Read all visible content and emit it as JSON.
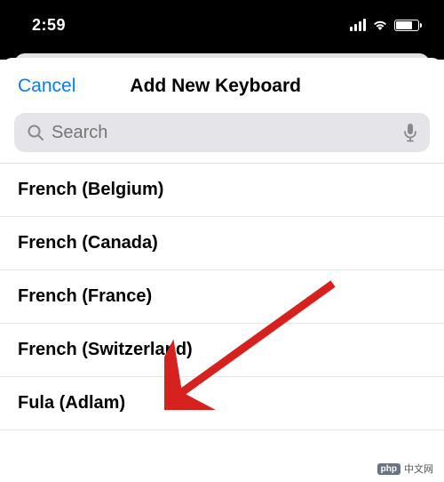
{
  "status": {
    "time": "2:59"
  },
  "nav": {
    "cancel": "Cancel",
    "title": "Add New Keyboard"
  },
  "search": {
    "placeholder": "Search"
  },
  "list": {
    "items": [
      {
        "label": "French (Belgium)"
      },
      {
        "label": "French (Canada)"
      },
      {
        "label": "French (France)"
      },
      {
        "label": "French (Switzerland)"
      },
      {
        "label": "Fula (Adlam)"
      }
    ]
  },
  "annotation": {
    "arrow_color": "#d6211e",
    "target_index": 2
  },
  "watermark": {
    "logo": "php",
    "text": "中文网"
  }
}
